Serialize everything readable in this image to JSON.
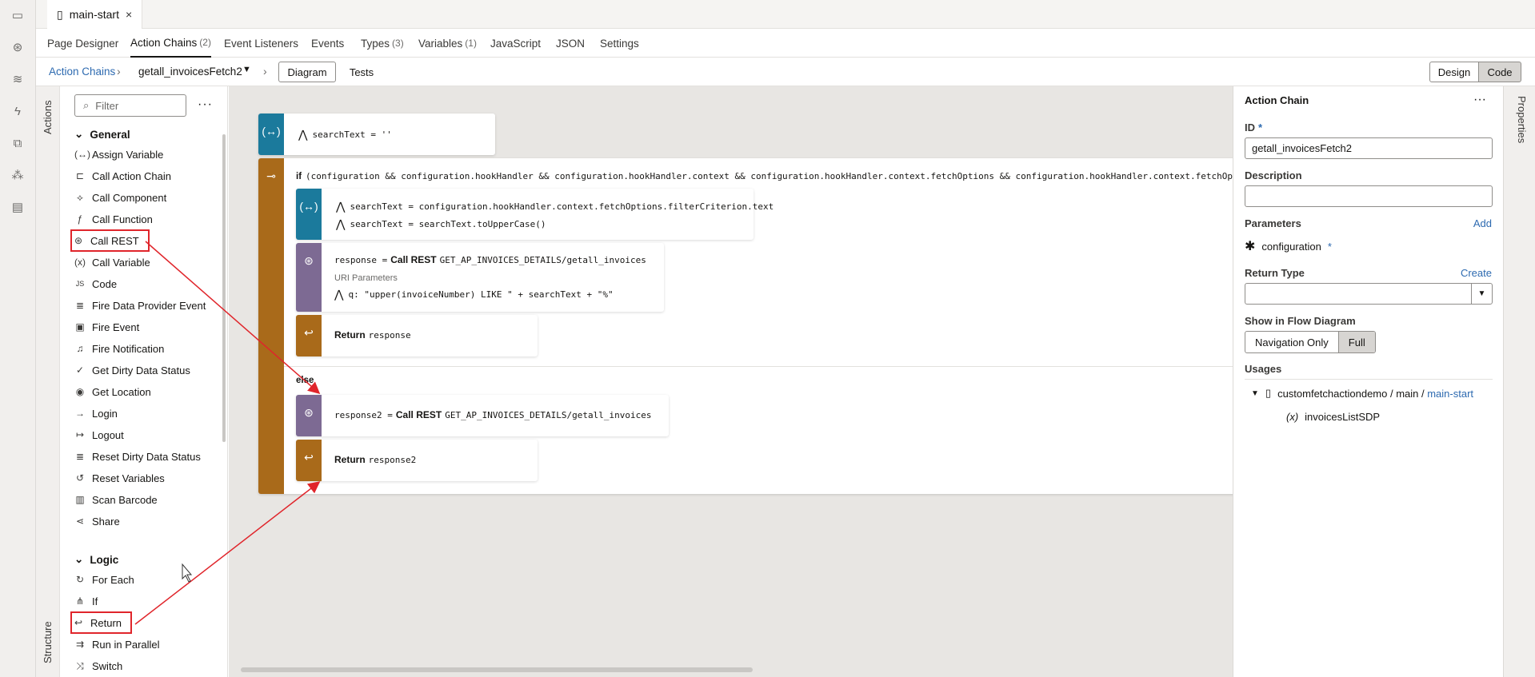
{
  "file_tab": {
    "label": "main-start",
    "close": "×"
  },
  "activity_icons": [
    "monitor-icon",
    "rest-icon",
    "database-icon",
    "lightning-icon",
    "puzzle-icon",
    "components-icon",
    "document-icon"
  ],
  "editor_tabs": [
    {
      "label": "Page Designer",
      "count": ""
    },
    {
      "label": "Action Chains",
      "count": "(2)"
    },
    {
      "label": "Event Listeners",
      "count": ""
    },
    {
      "label": "Events",
      "count": ""
    },
    {
      "label": "Types",
      "count": "(3)"
    },
    {
      "label": "Variables",
      "count": "(1)"
    },
    {
      "label": "JavaScript",
      "count": ""
    },
    {
      "label": "JSON",
      "count": ""
    },
    {
      "label": "Settings",
      "count": ""
    }
  ],
  "breadcrumb": {
    "root": "Action Chains",
    "chain": "getall_invoicesFetch2",
    "diagram": "Diagram",
    "tests": "Tests",
    "design": "Design",
    "code": "Code"
  },
  "side_tabs": {
    "actions": "Actions",
    "structure": "Structure",
    "properties": "Properties"
  },
  "palette": {
    "filter_placeholder": "Filter",
    "more": "···",
    "general_label": "General",
    "general": [
      {
        "icon": "(↔)",
        "label": "Assign Variable"
      },
      {
        "icon": "⊏",
        "label": "Call Action Chain"
      },
      {
        "icon": "⟡",
        "label": "Call Component"
      },
      {
        "icon": "ƒ",
        "label": "Call Function"
      },
      {
        "icon": "⊛",
        "label": "Call REST"
      },
      {
        "icon": "(x)",
        "label": "Call Variable"
      },
      {
        "icon": "JS",
        "label": "Code"
      },
      {
        "icon": "≣",
        "label": "Fire Data Provider Event"
      },
      {
        "icon": "▣",
        "label": "Fire Event"
      },
      {
        "icon": "♫",
        "label": "Fire Notification"
      },
      {
        "icon": "✓",
        "label": "Get Dirty Data Status"
      },
      {
        "icon": "◉",
        "label": "Get Location"
      },
      {
        "icon": "→",
        "label": "Login"
      },
      {
        "icon": "↦",
        "label": "Logout"
      },
      {
        "icon": "≣",
        "label": "Reset Dirty Data Status"
      },
      {
        "icon": "↺",
        "label": "Reset Variables"
      },
      {
        "icon": "▥",
        "label": "Scan Barcode"
      },
      {
        "icon": "⋖",
        "label": "Share"
      }
    ],
    "logic_label": "Logic",
    "logic": [
      {
        "icon": "↻",
        "label": "For Each"
      },
      {
        "icon": "⋔",
        "label": "If"
      },
      {
        "icon": "↩",
        "label": "Return"
      },
      {
        "icon": "⇉",
        "label": "Run in Parallel"
      },
      {
        "icon": "⤨",
        "label": "Switch"
      }
    ]
  },
  "diagram": {
    "assign1": "searchText = ''",
    "if_keyword": "if",
    "if_condition": "(configuration && configuration.hookHandler && configuration.hookHandler.context && configuration.hookHandler.context.fetchOptions && configuration.hookHandler.context.fetchOp",
    "assign2_line1": "searchText = configuration.hookHandler.context.fetchOptions.filterCriterion.text",
    "assign2_line2": "searchText = searchText.toUpperCase()",
    "rest1_var": "response = ",
    "rest1_call": "Call REST",
    "rest1_endpoint": " GET_AP_INVOICES_DETAILS/getall_invoices",
    "uri_params": "URI Parameters",
    "uri_q": "q: \"upper(invoiceNumber) LIKE \" + searchText + \"%\"",
    "return_kw": "Return",
    "return1_val": " response",
    "else_label": "else",
    "rest2_var": "response2 = ",
    "rest2_call": "Call REST",
    "rest2_endpoint": " GET_AP_INVOICES_DETAILS/getall_invoices",
    "return2_val": " response2"
  },
  "properties": {
    "title": "Action Chain",
    "more": "···",
    "id_label": "ID",
    "id_value": "getall_invoicesFetch2",
    "description_label": "Description",
    "parameters_label": "Parameters",
    "add_link": "Add",
    "param_name": "configuration",
    "return_type_label": "Return Type",
    "create_link": "Create",
    "flow_label": "Show in Flow Diagram",
    "flow_nav": "Navigation Only",
    "flow_full": "Full",
    "usages_label": "Usages",
    "usage_path_prefix": "customfetchactiondemo / main / ",
    "usage_path_link": "main-start",
    "usage_var": "invoicesListSDP"
  },
  "colors": {
    "annotation": "#e0252b",
    "assign": "#1b7a9c",
    "rest": "#7d6a93",
    "control": "#a96a1a",
    "link": "#2d6ab0"
  }
}
